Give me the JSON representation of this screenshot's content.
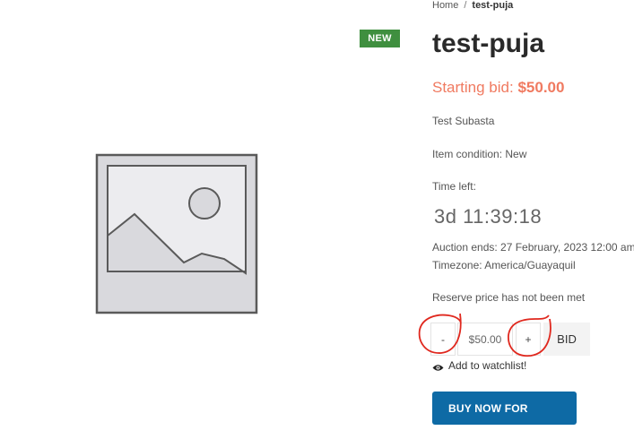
{
  "breadcrumb": {
    "home": "Home",
    "separator": "/",
    "current": "test-puja"
  },
  "badge": {
    "label": "NEW",
    "color": "#3f8f3f"
  },
  "product": {
    "title": "test-puja",
    "starting_bid_label": "Starting bid:",
    "starting_bid_amount": "$50.00",
    "description": "Test Subasta",
    "condition": "Item condition: New",
    "time_left_label": "Time left:",
    "countdown": "3d 11:39:18",
    "auction_ends": "Auction ends: 27 February, 2023 12:00 am",
    "timezone": "Timezone: America/Guayaquil",
    "reserve": "Reserve price has not been met"
  },
  "bid_form": {
    "minus": "-",
    "plus": "+",
    "value": "$50.00",
    "bid_label": "BID"
  },
  "watchlist": {
    "label": "Add to watchlist!",
    "icon": "eye-icon"
  },
  "buy_now": {
    "label": "BUY NOW FOR",
    "color": "#0e6aa5"
  },
  "image": {
    "icon": "image-placeholder-icon"
  },
  "colors": {
    "accent": "#f07a60",
    "annotation": "#e0281e"
  }
}
